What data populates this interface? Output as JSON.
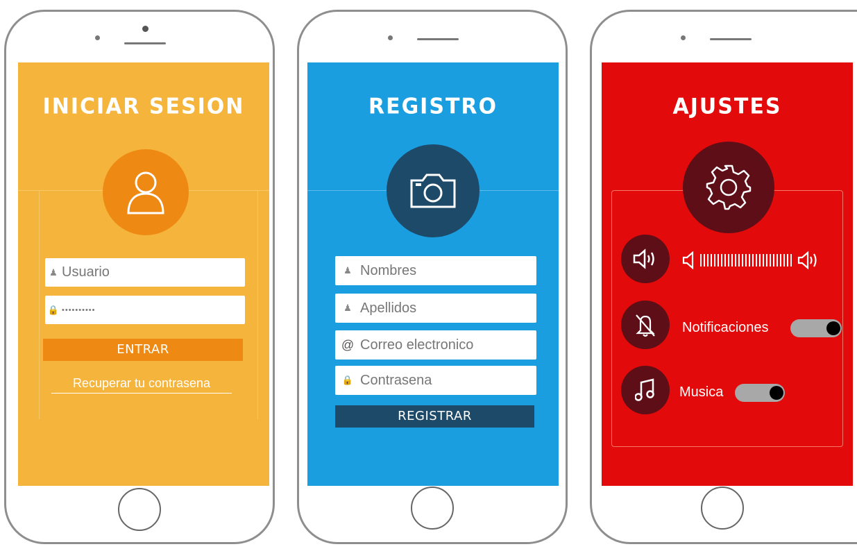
{
  "colors": {
    "login_bg": "#f5b43b",
    "login_accent": "#ee8a14",
    "register_bg": "#1a9ee0",
    "register_accent": "#1e4a6a",
    "settings_bg": "#e20a0a",
    "settings_accent": "#5e0e17"
  },
  "login": {
    "title": "INICIAR SESION",
    "icon": "user-icon",
    "username_placeholder": "Usuario",
    "password_value": "••••••••••",
    "submit_label": "ENTRAR",
    "recover_link": "Recuperar tu contrasena"
  },
  "register": {
    "title": "REGISTRO",
    "icon": "camera-icon",
    "fields": {
      "names": "Nombres",
      "surnames": "Apellidos",
      "email": "Correo electronico",
      "password": "Contrasena"
    },
    "email_symbol": "@",
    "submit_label": "REGISTRAR"
  },
  "settings": {
    "title": "AJUSTES",
    "icon": "gear-icon",
    "volume": {
      "icon": "speaker-icon",
      "level": 1.0
    },
    "notifications": {
      "icon": "bell-off-icon",
      "label": "Notificaciones",
      "enabled": true
    },
    "music": {
      "icon": "music-note-icon",
      "label": "Musica",
      "enabled": true
    }
  }
}
